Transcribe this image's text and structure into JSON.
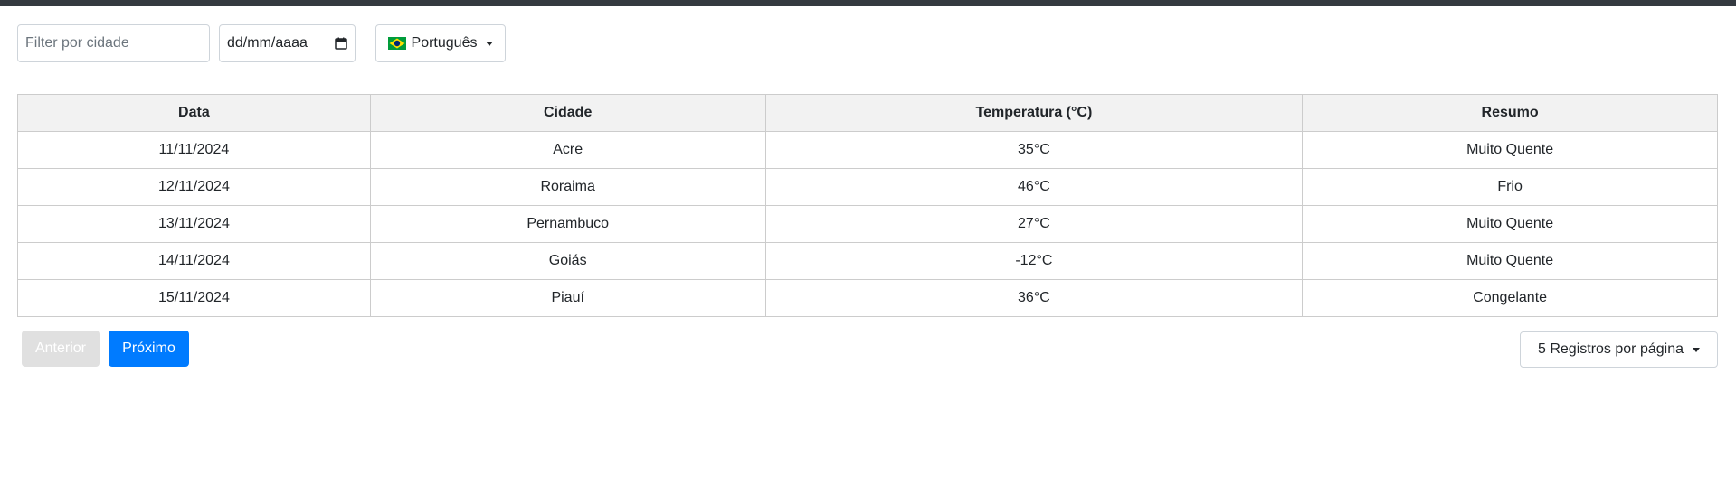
{
  "filters": {
    "city_placeholder": "Filter por cidade",
    "date_placeholder": "dd/mm/aaaa",
    "language_label": "Português",
    "language_flag_icon": "brazil-flag-icon"
  },
  "table": {
    "headers": [
      "Data",
      "Cidade",
      "Temperatura (°C)",
      "Resumo"
    ],
    "rows": [
      [
        "11/11/2024",
        "Acre",
        "35°C",
        "Muito Quente"
      ],
      [
        "12/11/2024",
        "Roraima",
        "46°C",
        "Frio"
      ],
      [
        "13/11/2024",
        "Pernambuco",
        "27°C",
        "Muito Quente"
      ],
      [
        "14/11/2024",
        "Goiás",
        "-12°C",
        "Muito Quente"
      ],
      [
        "15/11/2024",
        "Piauí",
        "36°C",
        "Congelante"
      ]
    ]
  },
  "pagination": {
    "prev_label": "Anterior",
    "next_label": "Próximo",
    "page_size_label": "5 Registros por página"
  },
  "colors": {
    "top_bar": "#343a40",
    "primary": "#007bff",
    "disabled": "#e0e0e0",
    "header_bg": "#f2f2f2"
  }
}
